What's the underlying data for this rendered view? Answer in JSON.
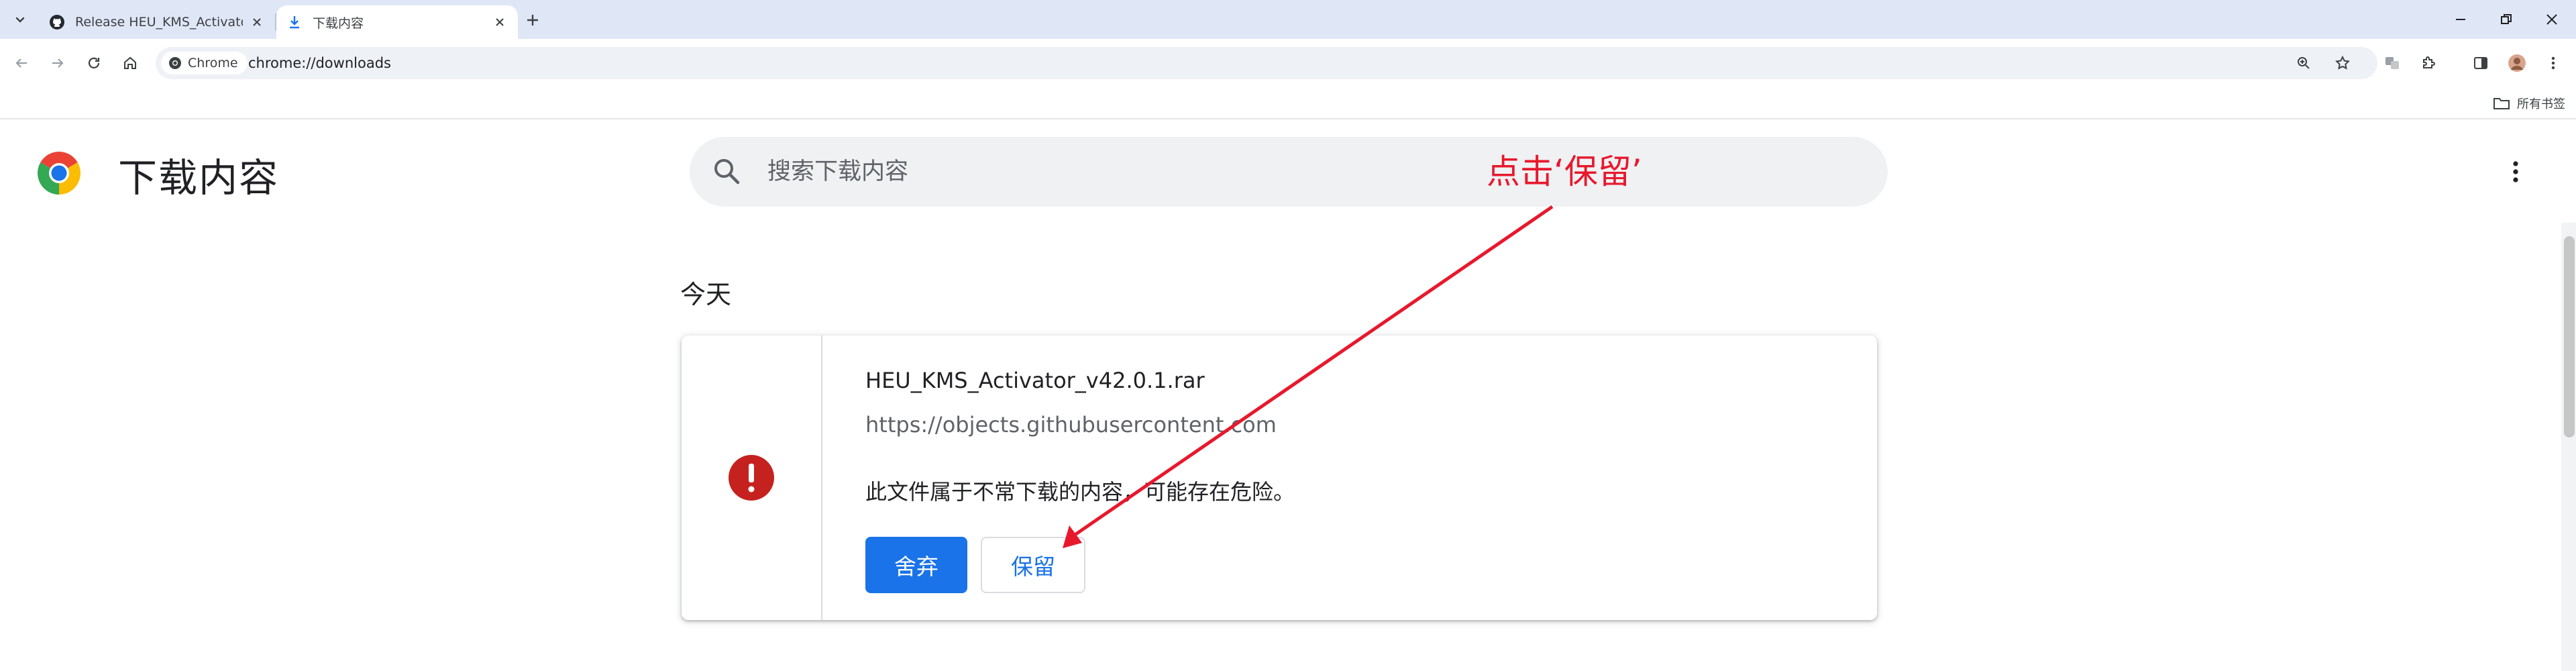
{
  "browser": {
    "tabs": [
      {
        "title": "Release HEU_KMS_Activator",
        "favicon": "github-icon",
        "active": false
      },
      {
        "title": "下载内容",
        "favicon": "download-icon",
        "active": true
      }
    ],
    "address": {
      "chip_label": "Chrome",
      "url": "chrome://downloads"
    },
    "bookmarks": {
      "all_bookmarks_label": "所有书签"
    }
  },
  "downloads": {
    "title": "下载内容",
    "search_placeholder": "搜索下载内容",
    "section_label": "今天",
    "items": [
      {
        "file_name": "HEU_KMS_Activator_v42.0.1.rar",
        "source_url": "https://objects.githubusercontent.com",
        "warning": "此文件属于不常下载的内容，可能存在危险。",
        "discard_label": "舍弃",
        "keep_label": "保留"
      }
    ]
  },
  "annotation": {
    "text": "点击‘保留’",
    "color": "#e8182c"
  },
  "colors": {
    "tabstrip_bg": "#dfe7f7",
    "primary_blue": "#1a73e8",
    "warning_red": "#c5221f"
  }
}
